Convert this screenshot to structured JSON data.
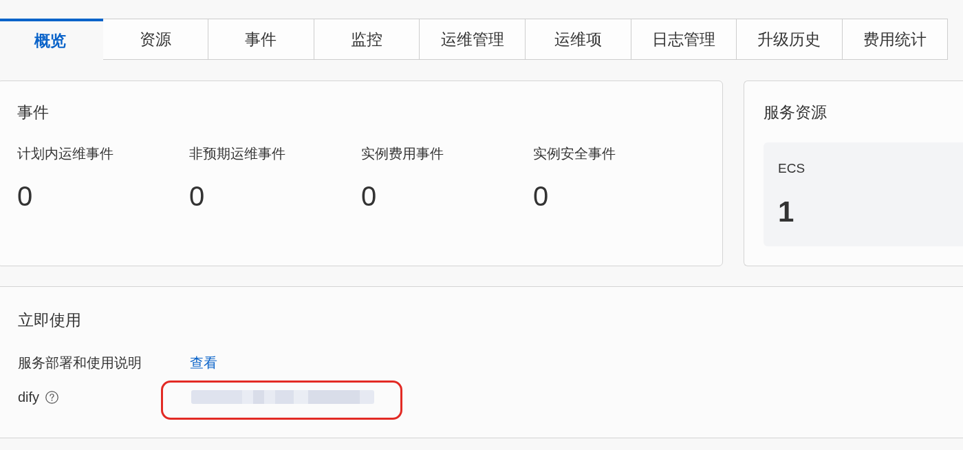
{
  "tabs": [
    {
      "label": "概览",
      "selected": true
    },
    {
      "label": "资源",
      "selected": false
    },
    {
      "label": "事件",
      "selected": false
    },
    {
      "label": "监控",
      "selected": false
    },
    {
      "label": "运维管理",
      "selected": false
    },
    {
      "label": "运维项",
      "selected": false
    },
    {
      "label": "日志管理",
      "selected": false
    },
    {
      "label": "升级历史",
      "selected": false
    },
    {
      "label": "费用统计",
      "selected": false
    }
  ],
  "events_card": {
    "title": "事件",
    "stats": [
      {
        "label": "计划内运维事件",
        "value": "0"
      },
      {
        "label": "非预期运维事件",
        "value": "0"
      },
      {
        "label": "实例费用事件",
        "value": "0"
      },
      {
        "label": "实例安全事件",
        "value": "0"
      }
    ]
  },
  "resources_card": {
    "title": "服务资源",
    "tiles": [
      {
        "label": "ECS",
        "value": "1"
      }
    ]
  },
  "quick_start": {
    "title": "立即使用",
    "rows": [
      {
        "label": "服务部署和使用说明",
        "kind": "link",
        "link": "查看",
        "help": false,
        "highlighted": false
      },
      {
        "label": "dify",
        "kind": "redacted",
        "help": true,
        "highlighted": true
      }
    ]
  }
}
